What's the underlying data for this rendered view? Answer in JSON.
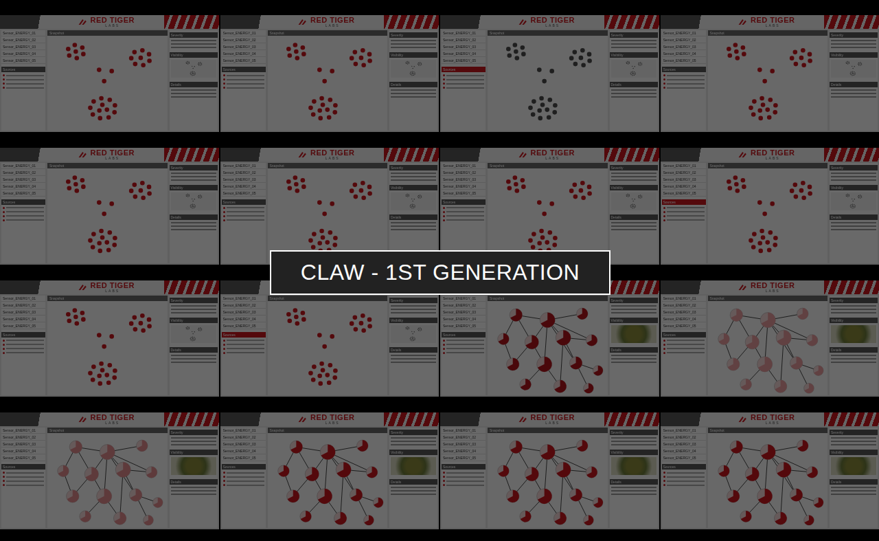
{
  "title": "CLAW - 1ST GENERATION",
  "brand": {
    "name": "RED TIGER",
    "sub": "LABS"
  },
  "panel": {
    "snapshot": "Snapshot",
    "left_items": [
      "Sensor_ENERGY_01",
      "Sensor_ENERGY_02",
      "Sensor_ENERGY_03",
      "Sensor_ENERGY_04",
      "Sensor_ENERGY_05"
    ],
    "left_heading": "Sources",
    "right_headings": [
      "Severity",
      "Visibility",
      "Details"
    ]
  },
  "thumbnails": [
    {
      "kind": "clusters",
      "color": "#c8161d",
      "alert": false
    },
    {
      "kind": "clusters",
      "color": "#c8161d",
      "alert": false
    },
    {
      "kind": "clusters",
      "color": "#4a4a4a",
      "alert": true
    },
    {
      "kind": "clusters",
      "color": "#c8161d",
      "alert": false
    },
    {
      "kind": "clusters",
      "color": "#c8161d",
      "alert": false
    },
    {
      "kind": "clusters",
      "color": "#c8161d",
      "alert": false
    },
    {
      "kind": "clusters",
      "color": "#c8161d",
      "alert": false
    },
    {
      "kind": "clusters",
      "color": "#c8161d",
      "alert": true
    },
    {
      "kind": "clusters",
      "color": "#c8161d",
      "alert": false
    },
    {
      "kind": "clusters",
      "color": "#c8161d",
      "alert": true
    },
    {
      "kind": "graph",
      "color": "#b0141a",
      "alert": false
    },
    {
      "kind": "graph",
      "color": "#e89a9c",
      "alert": false
    },
    {
      "kind": "graph",
      "color": "#e08a8d",
      "alert": false
    },
    {
      "kind": "graph",
      "color": "#c8161d",
      "alert": false
    },
    {
      "kind": "graph",
      "color": "#c8161d",
      "alert": false
    },
    {
      "kind": "graph",
      "color": "#c8161d",
      "alert": false
    }
  ]
}
